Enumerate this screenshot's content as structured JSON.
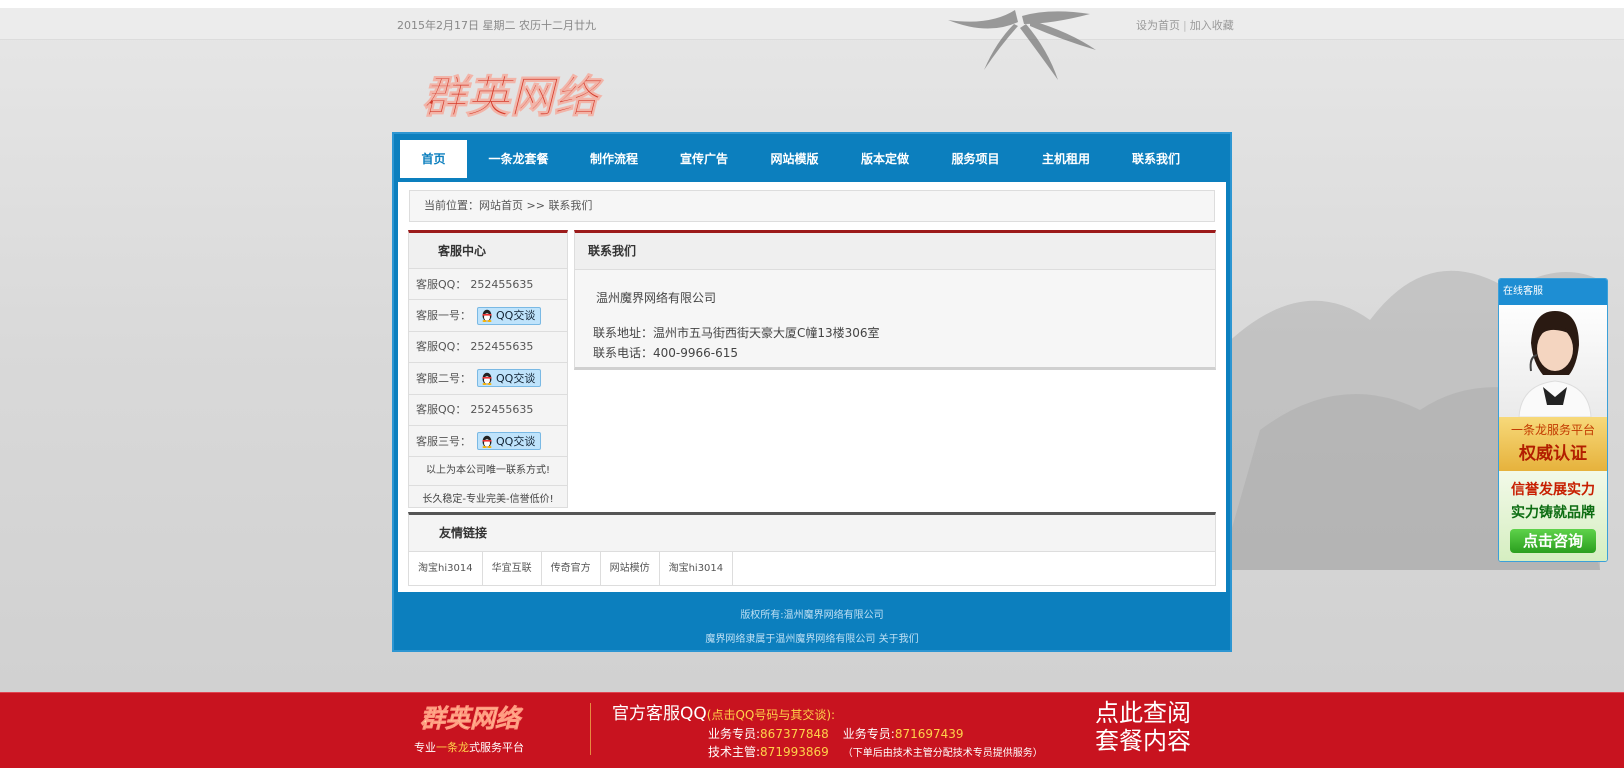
{
  "topbar": {
    "date": "2015年2月17日 星期二 农历十二月廿九",
    "set_home": "设为首页",
    "separator": "|",
    "add_fav": "加入收藏"
  },
  "logo_text": "群英网络",
  "nav": [
    {
      "label": "首页",
      "active": true
    },
    {
      "label": "一条龙套餐"
    },
    {
      "label": "制作流程"
    },
    {
      "label": "宣传广告"
    },
    {
      "label": "网站模版"
    },
    {
      "label": "版本定做"
    },
    {
      "label": "服务项目"
    },
    {
      "label": "主机租用"
    },
    {
      "label": "联系我们"
    }
  ],
  "breadcrumb": {
    "prefix": "当前位置：",
    "home": "网站首页",
    "sep": " >> ",
    "current": "联系我们"
  },
  "sidebar": {
    "title": "客服中心",
    "rows": [
      {
        "label": "客服QQ：",
        "value": "252455635"
      },
      {
        "label": "客服一号：",
        "button": "QQ交谈"
      },
      {
        "label": "客服QQ：",
        "value": "252455635"
      },
      {
        "label": "客服二号：",
        "button": "QQ交谈"
      },
      {
        "label": "客服QQ：",
        "value": "252455635"
      },
      {
        "label": "客服三号：",
        "button": "QQ交谈"
      }
    ],
    "note1": "以上为本公司唯一联系方式!",
    "note2": "长久稳定-专业完美-信誉低价!"
  },
  "main": {
    "title": "联系我们",
    "company": "温州魔界网络有限公司",
    "address": "联系地址：温州市五马街西街天豪大厦C幢13楼306室",
    "phone": "联系电话：400-9966-615"
  },
  "friends": {
    "title": "友情链接",
    "links": [
      "淘宝hi3014",
      "华宜互联",
      "传奇官方",
      "网站模仿",
      "淘宝hi3014"
    ]
  },
  "footer": {
    "line1": "版权所有:温州魔界网络有限公司",
    "line2": "魔界网络隶属于温州魔界网络有限公司 关于我们"
  },
  "kefu": {
    "header": "在线客服",
    "line1": "一条龙服务平台",
    "line2": "权威认证",
    "line3": "信誉发展实力",
    "line4": "实力铸就品牌",
    "button": "点击咨询"
  },
  "bottom": {
    "logo_text": "群英网络",
    "slogan_pre": "专业",
    "slogan_hl": "一条龙",
    "slogan_post": "式服务平台",
    "qq_title": "官方客服QQ",
    "qq_hint": "(点击QQ号码与其交谈):",
    "rep1_label": "业务专员:",
    "rep1": "867377848",
    "rep2_label": "业务专员:",
    "rep2": "871697439",
    "tech_label": "技术主管:",
    "tech": "871993869",
    "tech_note": "（下单后由技术主管分配技术专员提供服务）",
    "cta_line1": "点此查阅",
    "cta_line2": "套餐内容"
  }
}
